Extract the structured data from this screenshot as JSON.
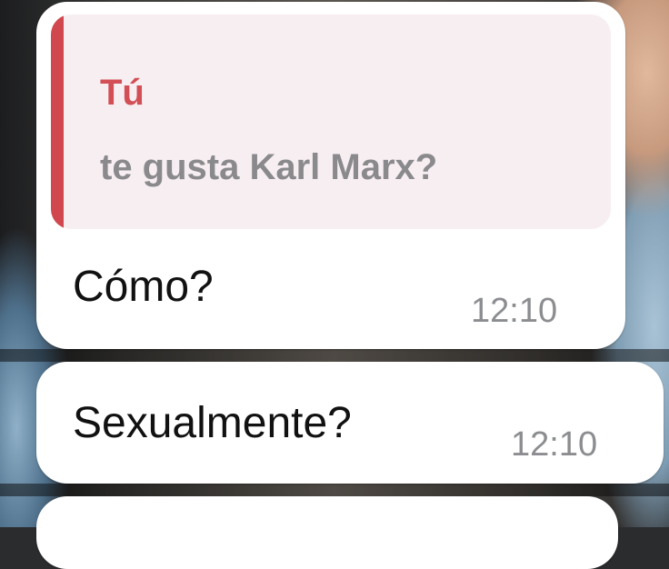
{
  "chat": {
    "messages": [
      {
        "reply_to": {
          "author": "Tú",
          "text": "te gusta  Karl Marx?"
        },
        "text": "Cómo?",
        "time": "12:10"
      },
      {
        "text": "Sexualmente?",
        "time": "12:10"
      }
    ]
  },
  "colors": {
    "bubble_background": "#ffffff",
    "quote_background": "#f7eef2",
    "quote_accent": "#d0474d",
    "quote_author": "#d24f55",
    "quote_text": "#8a8a8d",
    "message_text": "#111111",
    "timestamp": "#8b8d90"
  }
}
